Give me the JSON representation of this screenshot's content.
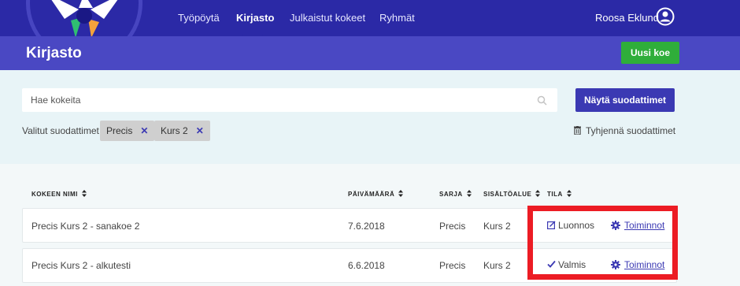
{
  "nav": {
    "items": [
      {
        "label": "Työpöytä"
      },
      {
        "label": "Kirjasto"
      },
      {
        "label": "Julkaistut kokeet"
      },
      {
        "label": "Ryhmät"
      }
    ],
    "active": "Kirjasto",
    "user_name": "Roosa Eklund"
  },
  "header": {
    "title": "Kirjasto",
    "new_exam_label": "Uusi koe"
  },
  "search": {
    "placeholder": "Hae kokeita",
    "value": "",
    "show_filters_label": "Näytä suodattimet",
    "selected_filters_label": "Valitut suodattimet",
    "selected_filters": [
      "Precis",
      "Kurs 2"
    ],
    "clear_filters_label": "Tyhjennä suodattimet"
  },
  "table": {
    "columns": [
      "KOKEEN NIMI",
      "PÄIVÄMÄÄRÄ",
      "SARJA",
      "SISÄLTÖALUE",
      "TILA"
    ],
    "rows": [
      {
        "name": "Precis Kurs 2 - sanakoe 2",
        "date": "7.6.2018",
        "series": "Precis",
        "content_area": "Kurs 2",
        "status": "Luonnos",
        "status_icon": "edit-icon",
        "actions": "Toiminnot"
      },
      {
        "name": "Precis Kurs 2 - alkutesti",
        "date": "6.6.2018",
        "series": "Precis",
        "content_area": "Kurs 2",
        "status": "Valmis",
        "status_icon": "check-icon",
        "actions": "Toiminnot"
      }
    ]
  },
  "colors": {
    "nav_bg": "#2b29a6",
    "title_band": "#4a48c3",
    "new_exam_button": "#2fae3a",
    "primary_button": "#3b39b3",
    "highlight": "#ec1c24"
  }
}
